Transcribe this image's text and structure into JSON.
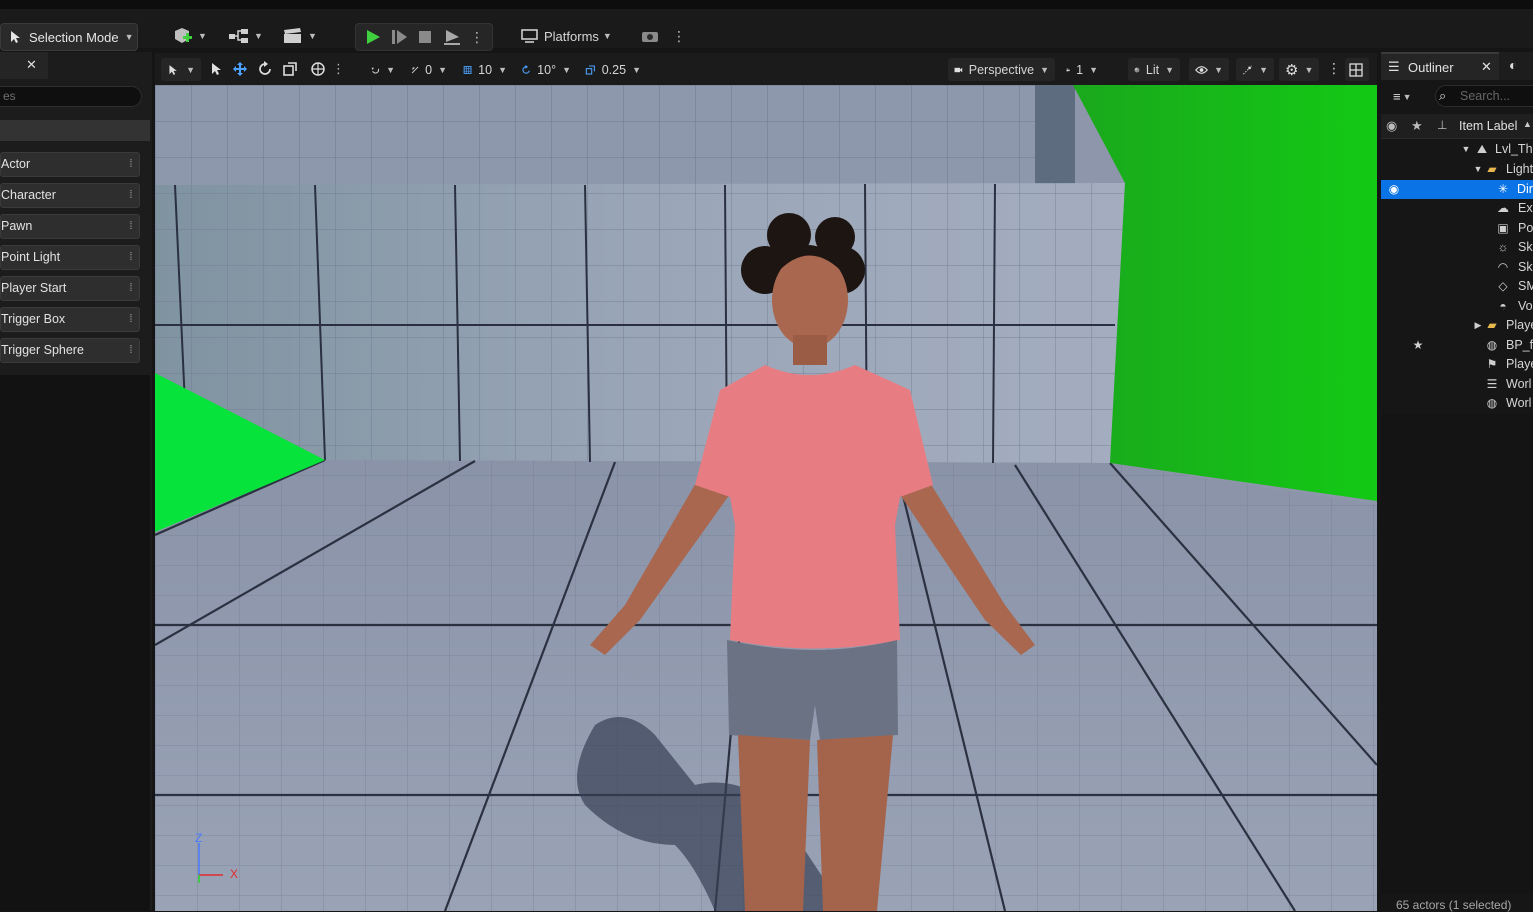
{
  "toolbar": {
    "selection_mode_label": "Selection Mode",
    "platforms_label": "Platforms"
  },
  "left_panel": {
    "search_placeholder": "es",
    "items": [
      {
        "label": "Actor"
      },
      {
        "label": "Character"
      },
      {
        "label": "Pawn"
      },
      {
        "label": "Point Light"
      },
      {
        "label": "Player Start"
      },
      {
        "label": "Trigger Box"
      },
      {
        "label": "Trigger Sphere"
      }
    ]
  },
  "viewport": {
    "translate_snap": "0",
    "grid_snap": "10",
    "rotate_snap": "10°",
    "scale_snap": "0.25",
    "view_mode": "Perspective",
    "camera_speed": "1",
    "lighting_mode": "Lit",
    "axis_z": "Z",
    "axis_x": "X"
  },
  "outliner": {
    "title": "Outliner",
    "search_placeholder": "Search...",
    "column_label": "Item Label",
    "rows": [
      {
        "label": "Lvl_Th",
        "icon": "level-icon"
      },
      {
        "label": "Light",
        "icon": "folder-icon"
      },
      {
        "label": "Dir",
        "icon": "directional-light-icon"
      },
      {
        "label": "Ex",
        "icon": "exponential-fog-icon"
      },
      {
        "label": "Po",
        "icon": "post-process-icon"
      },
      {
        "label": "Sk",
        "icon": "sky-atmosphere-icon"
      },
      {
        "label": "Sk",
        "icon": "sky-light-icon"
      },
      {
        "label": "SM",
        "icon": "static-mesh-icon"
      },
      {
        "label": "Vo",
        "icon": "volumetric-cloud-icon"
      },
      {
        "label": "Playe",
        "icon": "folder-icon"
      },
      {
        "label": "BP_f",
        "icon": "blueprint-icon"
      },
      {
        "label": "Playe",
        "icon": "player-start-icon"
      },
      {
        "label": "Worl",
        "icon": "world-data-layers-icon"
      },
      {
        "label": "Worl",
        "icon": "world-partition-icon"
      }
    ],
    "footer": "65 actors (1 selected)"
  },
  "colors": {
    "selection_blue": "#0a74e6",
    "play_green": "#3fcf3f",
    "green_screen": "#17c21a"
  }
}
